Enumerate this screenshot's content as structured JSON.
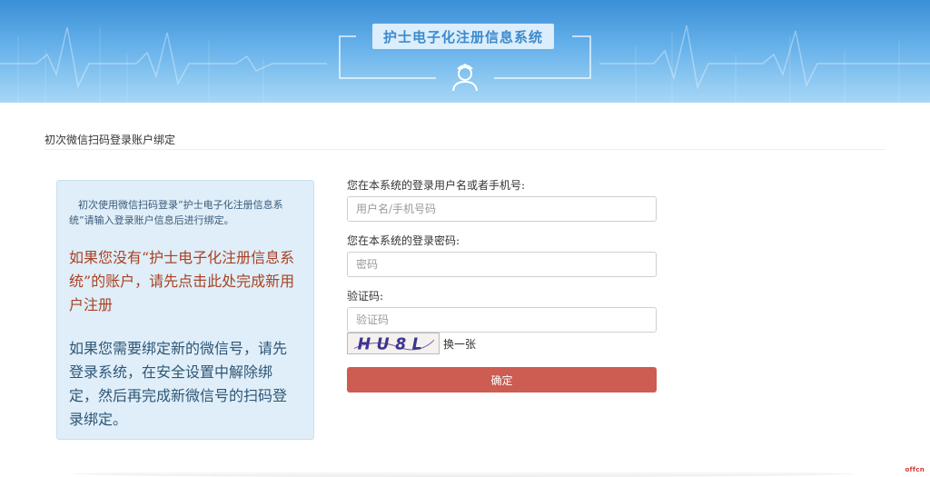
{
  "banner": {
    "title": "护士电子化注册信息系统"
  },
  "page": {
    "section_title": "初次微信扫码登录账户绑定"
  },
  "info_panel": {
    "note": "初次使用微信扫码登录“护士电子化注册信息系统”请输入登录账户信息后进行绑定。",
    "register_text": "如果您没有“护士电子化注册信息系统”的账户，请先点击此处完成新用户注册",
    "rebind_text": "如果您需要绑定新的微信号，请先登录系统，在安全设置中解除绑定，然后再完成新微信号的扫码登录绑定。"
  },
  "form": {
    "username_label": "您在本系统的登录用户名或者手机号:",
    "username_placeholder": "用户名/手机号码",
    "password_label": "您在本系统的登录密码:",
    "password_placeholder": "密码",
    "captcha_label": "验证码:",
    "captcha_placeholder": "验证码",
    "captcha_text": "HU8L",
    "refresh_label": "换一张",
    "submit_label": "确定"
  },
  "watermark": "offcn",
  "colors": {
    "banner_accent": "#3b8bd0",
    "submit_button": "#cd5c52",
    "register_link": "#a94224",
    "panel_background": "#dfeef8"
  }
}
